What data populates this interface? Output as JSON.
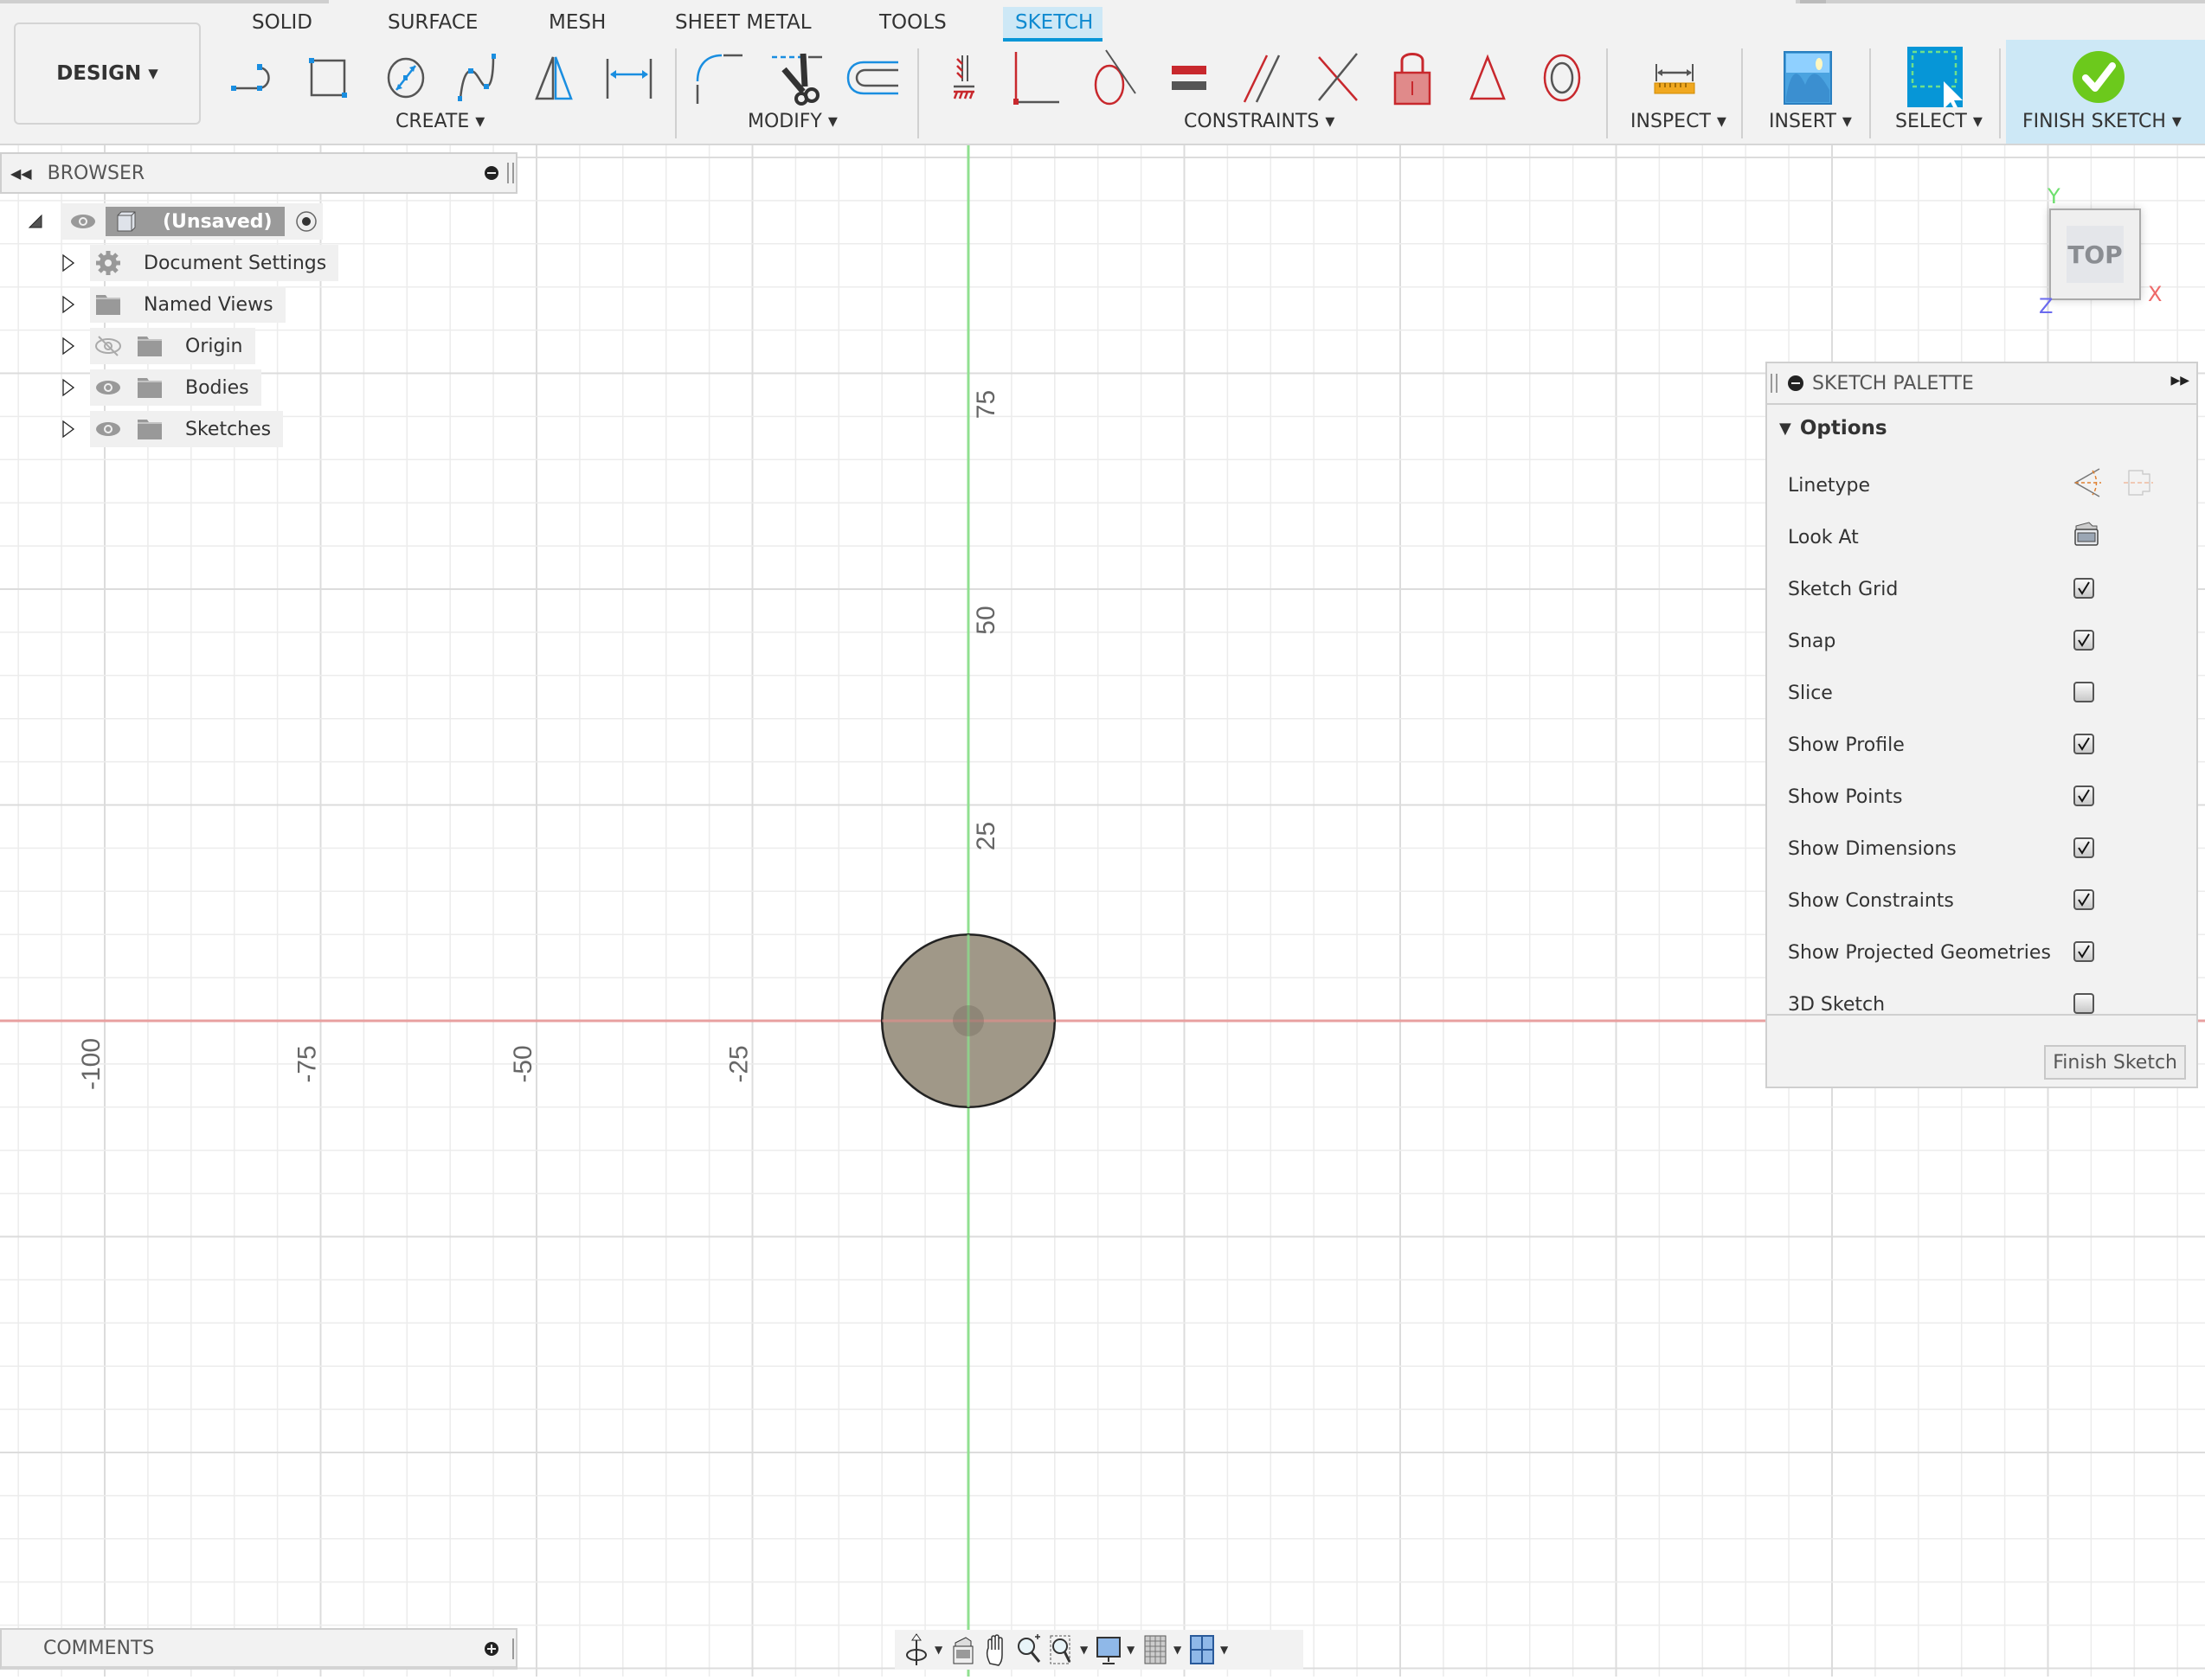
{
  "toolbar": {
    "workspace_button": "DESIGN ▾",
    "tabs": [
      {
        "label": "SOLID",
        "active": false
      },
      {
        "label": "SURFACE",
        "active": false
      },
      {
        "label": "MESH",
        "active": false
      },
      {
        "label": "SHEET METAL",
        "active": false
      },
      {
        "label": "TOOLS",
        "active": false
      },
      {
        "label": "SKETCH",
        "active": true
      }
    ],
    "groups": {
      "create": "CREATE ▾",
      "modify": "MODIFY ▾",
      "constraints": "CONSTRAINTS ▾",
      "inspect": "INSPECT ▾",
      "insert": "INSERT ▾",
      "select": "SELECT ▾",
      "finish_sketch": "FINISH SKETCH ▾"
    },
    "create_tools": [
      "line-icon",
      "rectangle-icon",
      "circle-icon",
      "spline-icon",
      "mirror-icon",
      "dimension-icon"
    ],
    "modify_tools": [
      "fillet-icon",
      "trim-icon",
      "offset-icon"
    ],
    "constraint_tools": [
      "fix-icon",
      "coincident-icon",
      "tangent-icon",
      "equal-icon",
      "parallel-icon",
      "perpendicular-icon",
      "lock-icon",
      "midpoint-icon",
      "concentric-icon"
    ],
    "colors": {
      "accent": "#0696d7",
      "constraint": "#c8282d",
      "finish": "#6cc91c"
    }
  },
  "browser": {
    "title": "BROWSER",
    "root": {
      "label": "(Unsaved)"
    },
    "items": [
      {
        "label": "Document Settings",
        "icon": "gear-icon",
        "visibility": "none"
      },
      {
        "label": "Named Views",
        "icon": "folder-icon",
        "visibility": "none"
      },
      {
        "label": "Origin",
        "icon": "folder-icon",
        "visibility": "hidden"
      },
      {
        "label": "Bodies",
        "icon": "folder-icon",
        "visibility": "visible"
      },
      {
        "label": "Sketches",
        "icon": "folder-icon",
        "visibility": "visible"
      }
    ]
  },
  "viewcube": {
    "face": "TOP",
    "x": "X",
    "y": "Y",
    "z": "Z"
  },
  "palette": {
    "title": "SKETCH PALETTE",
    "section": "Options",
    "rows": [
      {
        "label": "Linetype",
        "type": "linetype"
      },
      {
        "label": "Look At",
        "type": "lookat"
      },
      {
        "label": "Sketch Grid",
        "type": "checkbox",
        "checked": true
      },
      {
        "label": "Snap",
        "type": "checkbox",
        "checked": true
      },
      {
        "label": "Slice",
        "type": "checkbox",
        "checked": false
      },
      {
        "label": "Show Profile",
        "type": "checkbox",
        "checked": true
      },
      {
        "label": "Show Points",
        "type": "checkbox",
        "checked": true
      },
      {
        "label": "Show Dimensions",
        "type": "checkbox",
        "checked": true
      },
      {
        "label": "Show Constraints",
        "type": "checkbox",
        "checked": true
      },
      {
        "label": "Show Projected Geometries",
        "type": "checkbox",
        "checked": true
      },
      {
        "label": "3D Sketch",
        "type": "checkbox",
        "checked": false
      }
    ],
    "finish_button": "Finish Sketch"
  },
  "comments": {
    "title": "COMMENTS"
  },
  "navbar": [
    "orbit-icon",
    "look-at-icon",
    "pan-icon",
    "zoom-icon",
    "fit-icon",
    "display-settings-icon",
    "grid-settings-icon",
    "viewports-icon"
  ],
  "sketch": {
    "x_axis_labels": [
      "-100",
      "-75",
      "-50",
      "-25"
    ],
    "y_axis_labels": [
      "75",
      "50",
      "25"
    ],
    "major_grid_step": 25,
    "minor_grid_step": 5,
    "circle": {
      "center": [
        0,
        0
      ],
      "radius": 10
    },
    "colors": {
      "x_axis": "#e8a0a0",
      "y_axis": "#90e090",
      "profile_fill": "#a09888",
      "grid": "#ececec",
      "grid_major": "#dcdcdc"
    }
  }
}
